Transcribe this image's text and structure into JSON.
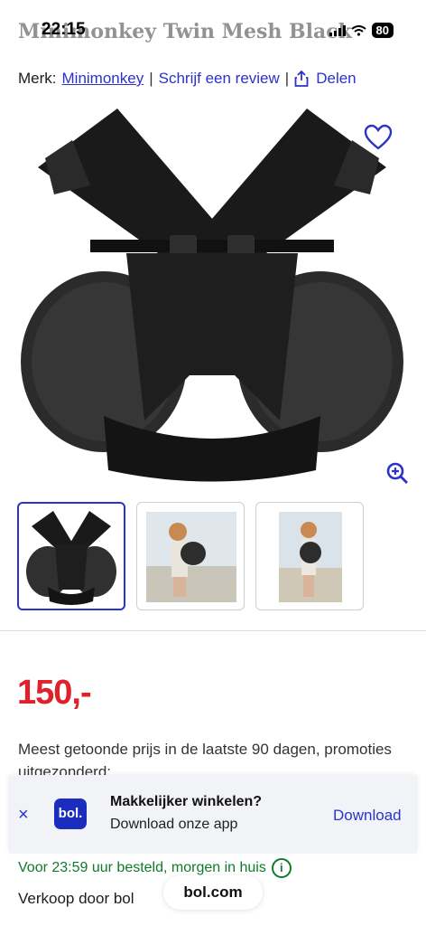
{
  "status_bar": {
    "time": "22:15",
    "battery": "80"
  },
  "product": {
    "title": "Minimonkey Twin Mesh Black",
    "brand_label": "Merk:",
    "brand_name": "Minimonkey",
    "separator": "|",
    "review_link": "Schrijf een review",
    "share_link": "Delen"
  },
  "gallery": {
    "thumbnails": [
      "carrier-photo",
      "model-photo-1",
      "model-photo-2"
    ],
    "active_index": 0
  },
  "price": {
    "value": "150,-",
    "note": "Meest getoonde prijs in de laatste 90 dagen, promoties uitgezonderd:"
  },
  "app_banner": {
    "logo_text": "bol.",
    "title": "Makkelijker winkelen?",
    "subtitle": "Download onze app",
    "download_label": "Download",
    "close_label": "×"
  },
  "delivery": {
    "text": "Voor 23:59 uur besteld, morgen in huis",
    "info_icon": "i"
  },
  "seller": {
    "text": "Verkoop door bol"
  },
  "browser": {
    "url": "bol.com"
  },
  "colors": {
    "accent": "#2b33c8",
    "price": "#e0202a",
    "delivery": "#0f7a2a"
  }
}
